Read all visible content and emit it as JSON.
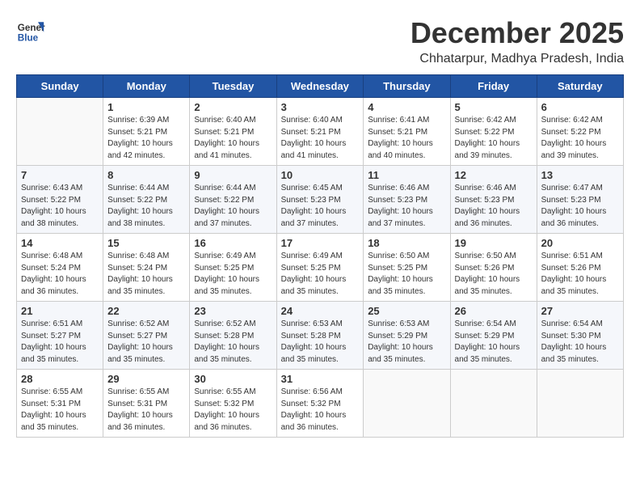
{
  "logo": {
    "line1": "General",
    "line2": "Blue"
  },
  "title": "December 2025",
  "subtitle": "Chhatarpur, Madhya Pradesh, India",
  "header_days": [
    "Sunday",
    "Monday",
    "Tuesday",
    "Wednesday",
    "Thursday",
    "Friday",
    "Saturday"
  ],
  "weeks": [
    [
      {
        "day": "",
        "sunrise": "",
        "sunset": "",
        "daylight": ""
      },
      {
        "day": "1",
        "sunrise": "Sunrise: 6:39 AM",
        "sunset": "Sunset: 5:21 PM",
        "daylight": "Daylight: 10 hours and 42 minutes."
      },
      {
        "day": "2",
        "sunrise": "Sunrise: 6:40 AM",
        "sunset": "Sunset: 5:21 PM",
        "daylight": "Daylight: 10 hours and 41 minutes."
      },
      {
        "day": "3",
        "sunrise": "Sunrise: 6:40 AM",
        "sunset": "Sunset: 5:21 PM",
        "daylight": "Daylight: 10 hours and 41 minutes."
      },
      {
        "day": "4",
        "sunrise": "Sunrise: 6:41 AM",
        "sunset": "Sunset: 5:21 PM",
        "daylight": "Daylight: 10 hours and 40 minutes."
      },
      {
        "day": "5",
        "sunrise": "Sunrise: 6:42 AM",
        "sunset": "Sunset: 5:22 PM",
        "daylight": "Daylight: 10 hours and 39 minutes."
      },
      {
        "day": "6",
        "sunrise": "Sunrise: 6:42 AM",
        "sunset": "Sunset: 5:22 PM",
        "daylight": "Daylight: 10 hours and 39 minutes."
      }
    ],
    [
      {
        "day": "7",
        "sunrise": "Sunrise: 6:43 AM",
        "sunset": "Sunset: 5:22 PM",
        "daylight": "Daylight: 10 hours and 38 minutes."
      },
      {
        "day": "8",
        "sunrise": "Sunrise: 6:44 AM",
        "sunset": "Sunset: 5:22 PM",
        "daylight": "Daylight: 10 hours and 38 minutes."
      },
      {
        "day": "9",
        "sunrise": "Sunrise: 6:44 AM",
        "sunset": "Sunset: 5:22 PM",
        "daylight": "Daylight: 10 hours and 37 minutes."
      },
      {
        "day": "10",
        "sunrise": "Sunrise: 6:45 AM",
        "sunset": "Sunset: 5:23 PM",
        "daylight": "Daylight: 10 hours and 37 minutes."
      },
      {
        "day": "11",
        "sunrise": "Sunrise: 6:46 AM",
        "sunset": "Sunset: 5:23 PM",
        "daylight": "Daylight: 10 hours and 37 minutes."
      },
      {
        "day": "12",
        "sunrise": "Sunrise: 6:46 AM",
        "sunset": "Sunset: 5:23 PM",
        "daylight": "Daylight: 10 hours and 36 minutes."
      },
      {
        "day": "13",
        "sunrise": "Sunrise: 6:47 AM",
        "sunset": "Sunset: 5:23 PM",
        "daylight": "Daylight: 10 hours and 36 minutes."
      }
    ],
    [
      {
        "day": "14",
        "sunrise": "Sunrise: 6:48 AM",
        "sunset": "Sunset: 5:24 PM",
        "daylight": "Daylight: 10 hours and 36 minutes."
      },
      {
        "day": "15",
        "sunrise": "Sunrise: 6:48 AM",
        "sunset": "Sunset: 5:24 PM",
        "daylight": "Daylight: 10 hours and 35 minutes."
      },
      {
        "day": "16",
        "sunrise": "Sunrise: 6:49 AM",
        "sunset": "Sunset: 5:25 PM",
        "daylight": "Daylight: 10 hours and 35 minutes."
      },
      {
        "day": "17",
        "sunrise": "Sunrise: 6:49 AM",
        "sunset": "Sunset: 5:25 PM",
        "daylight": "Daylight: 10 hours and 35 minutes."
      },
      {
        "day": "18",
        "sunrise": "Sunrise: 6:50 AM",
        "sunset": "Sunset: 5:25 PM",
        "daylight": "Daylight: 10 hours and 35 minutes."
      },
      {
        "day": "19",
        "sunrise": "Sunrise: 6:50 AM",
        "sunset": "Sunset: 5:26 PM",
        "daylight": "Daylight: 10 hours and 35 minutes."
      },
      {
        "day": "20",
        "sunrise": "Sunrise: 6:51 AM",
        "sunset": "Sunset: 5:26 PM",
        "daylight": "Daylight: 10 hours and 35 minutes."
      }
    ],
    [
      {
        "day": "21",
        "sunrise": "Sunrise: 6:51 AM",
        "sunset": "Sunset: 5:27 PM",
        "daylight": "Daylight: 10 hours and 35 minutes."
      },
      {
        "day": "22",
        "sunrise": "Sunrise: 6:52 AM",
        "sunset": "Sunset: 5:27 PM",
        "daylight": "Daylight: 10 hours and 35 minutes."
      },
      {
        "day": "23",
        "sunrise": "Sunrise: 6:52 AM",
        "sunset": "Sunset: 5:28 PM",
        "daylight": "Daylight: 10 hours and 35 minutes."
      },
      {
        "day": "24",
        "sunrise": "Sunrise: 6:53 AM",
        "sunset": "Sunset: 5:28 PM",
        "daylight": "Daylight: 10 hours and 35 minutes."
      },
      {
        "day": "25",
        "sunrise": "Sunrise: 6:53 AM",
        "sunset": "Sunset: 5:29 PM",
        "daylight": "Daylight: 10 hours and 35 minutes."
      },
      {
        "day": "26",
        "sunrise": "Sunrise: 6:54 AM",
        "sunset": "Sunset: 5:29 PM",
        "daylight": "Daylight: 10 hours and 35 minutes."
      },
      {
        "day": "27",
        "sunrise": "Sunrise: 6:54 AM",
        "sunset": "Sunset: 5:30 PM",
        "daylight": "Daylight: 10 hours and 35 minutes."
      }
    ],
    [
      {
        "day": "28",
        "sunrise": "Sunrise: 6:55 AM",
        "sunset": "Sunset: 5:31 PM",
        "daylight": "Daylight: 10 hours and 35 minutes."
      },
      {
        "day": "29",
        "sunrise": "Sunrise: 6:55 AM",
        "sunset": "Sunset: 5:31 PM",
        "daylight": "Daylight: 10 hours and 36 minutes."
      },
      {
        "day": "30",
        "sunrise": "Sunrise: 6:55 AM",
        "sunset": "Sunset: 5:32 PM",
        "daylight": "Daylight: 10 hours and 36 minutes."
      },
      {
        "day": "31",
        "sunrise": "Sunrise: 6:56 AM",
        "sunset": "Sunset: 5:32 PM",
        "daylight": "Daylight: 10 hours and 36 minutes."
      },
      {
        "day": "",
        "sunrise": "",
        "sunset": "",
        "daylight": ""
      },
      {
        "day": "",
        "sunrise": "",
        "sunset": "",
        "daylight": ""
      },
      {
        "day": "",
        "sunrise": "",
        "sunset": "",
        "daylight": ""
      }
    ]
  ]
}
